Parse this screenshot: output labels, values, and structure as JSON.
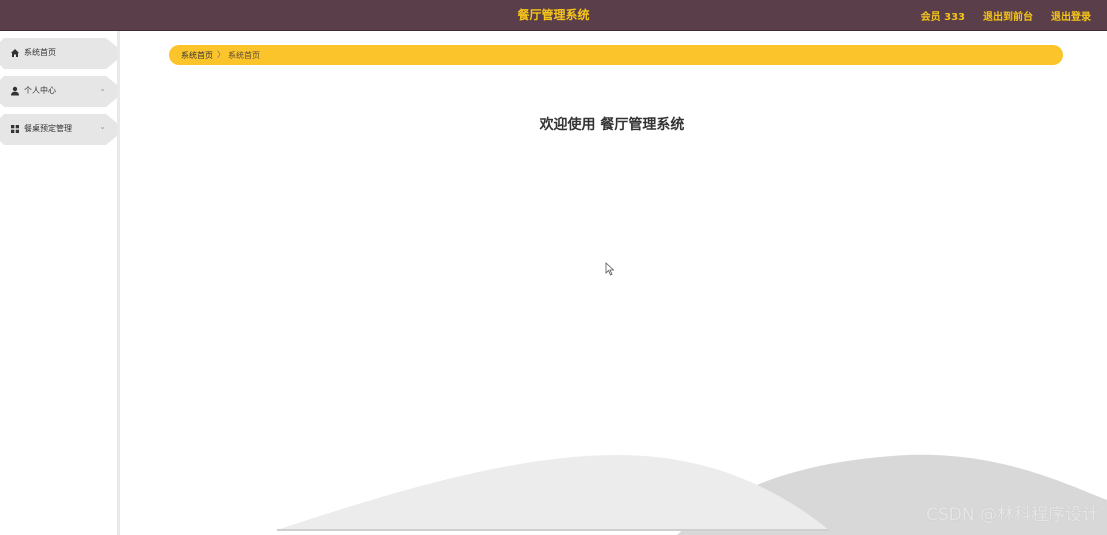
{
  "header": {
    "title": "餐厅管理系统",
    "links": [
      {
        "label": "会员 333"
      },
      {
        "label": "退出到前台"
      },
      {
        "label": "退出登录"
      }
    ]
  },
  "sidebar": {
    "items": [
      {
        "label": "系统首页",
        "icon": "home-icon"
      },
      {
        "label": "个人中心",
        "icon": "user-icon",
        "expandable": true
      },
      {
        "label": "餐桌预定管理",
        "icon": "grid-icon",
        "expandable": true
      }
    ]
  },
  "breadcrumb": {
    "items": [
      "系统首页",
      "系统首页"
    ],
    "separator": "〉"
  },
  "main": {
    "welcome": "欢迎使用 餐厅管理系统"
  },
  "watermark": "CSDN @林科程序设计",
  "colors": {
    "header_bg": "#5a3f4a",
    "accent": "#f5c518",
    "breadcrumb_bg": "#fbc42a",
    "menu_bg": "#e6e6e6"
  }
}
